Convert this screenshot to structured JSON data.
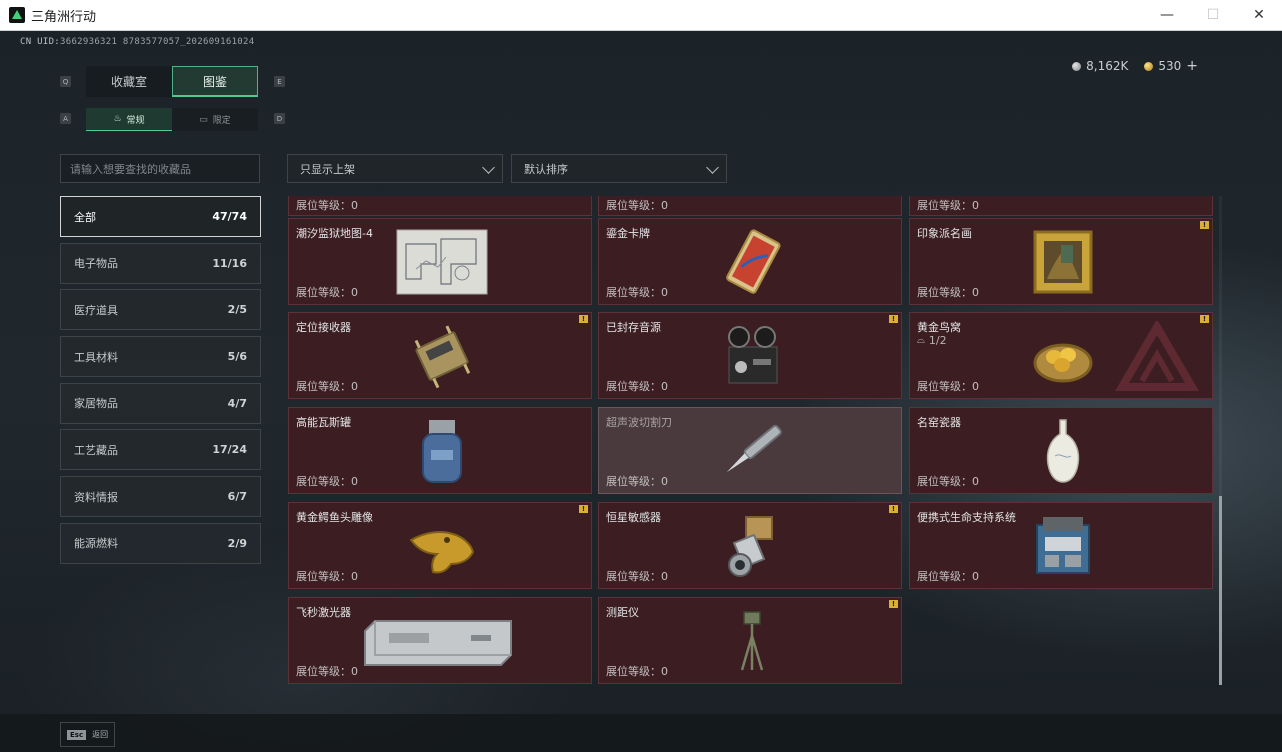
{
  "window": {
    "title": "三角洲行动",
    "minimize": "—",
    "maximize": "☐",
    "close": "✕"
  },
  "uid": {
    "prefix": "CN UID:",
    "value": "3662936321 8783577057_202609161024"
  },
  "currency": {
    "silver": "8,162K",
    "gold": "530",
    "plus": "+"
  },
  "key_hints": {
    "q": "Q",
    "e": "E",
    "a": "A",
    "d": "D"
  },
  "tabs": [
    {
      "label": "收藏室"
    },
    {
      "label": "图鉴"
    }
  ],
  "subtabs": [
    {
      "label": "常规",
      "icon": "flame-icon"
    },
    {
      "label": "限定",
      "icon": "ticket-icon"
    }
  ],
  "search": {
    "placeholder": "请输入想要查找的收藏品"
  },
  "filter": {
    "label": "只显示上架"
  },
  "sort": {
    "label": "默认排序"
  },
  "categories": [
    {
      "label": "全部",
      "count": "47/74"
    },
    {
      "label": "电子物品",
      "count": "11/16"
    },
    {
      "label": "医疗道具",
      "count": "2/5"
    },
    {
      "label": "工具材料",
      "count": "5/6"
    },
    {
      "label": "家居物品",
      "count": "4/7"
    },
    {
      "label": "工艺藏品",
      "count": "17/24"
    },
    {
      "label": "资料情报",
      "count": "6/7"
    },
    {
      "label": "能源燃料",
      "count": "2/9"
    }
  ],
  "level_label": "展位等级：0",
  "badge": "!",
  "items": [
    {
      "name": "潮汐监狱地图-4",
      "icon": "prison-map-icon"
    },
    {
      "name": "鎏金卡牌",
      "icon": "gilded-card-icon"
    },
    {
      "name": "印象派名画",
      "icon": "framed-painting-icon"
    },
    {
      "name": "定位接收器",
      "icon": "locator-receiver-icon"
    },
    {
      "name": "已封存音源",
      "icon": "reel-recorder-icon"
    },
    {
      "name": "黄金鸟窝",
      "icon": "golden-nest-icon",
      "sub": "1/2"
    },
    {
      "name": "高能瓦斯罐",
      "icon": "gas-canister-icon"
    },
    {
      "name": "超声波切割刀",
      "icon": "ultrasonic-cutter-icon"
    },
    {
      "name": "名窑瓷器",
      "icon": "porcelain-vase-icon"
    },
    {
      "name": "黄金鳄鱼头雕像",
      "icon": "golden-crocodile-icon"
    },
    {
      "name": "恒星敏感器",
      "icon": "star-sensor-icon"
    },
    {
      "name": "便携式生命支持系统",
      "icon": "life-support-icon"
    },
    {
      "name": "飞秒激光器",
      "icon": "femtosecond-laser-icon"
    },
    {
      "name": "测距仪",
      "icon": "rangefinder-icon"
    }
  ],
  "bottom": {
    "esc_key": "Esc",
    "esc_label": "返回"
  },
  "colors": {
    "accent": "#4fcb8e",
    "card_bg": "#3b1d22",
    "badge": "#d9b032"
  }
}
